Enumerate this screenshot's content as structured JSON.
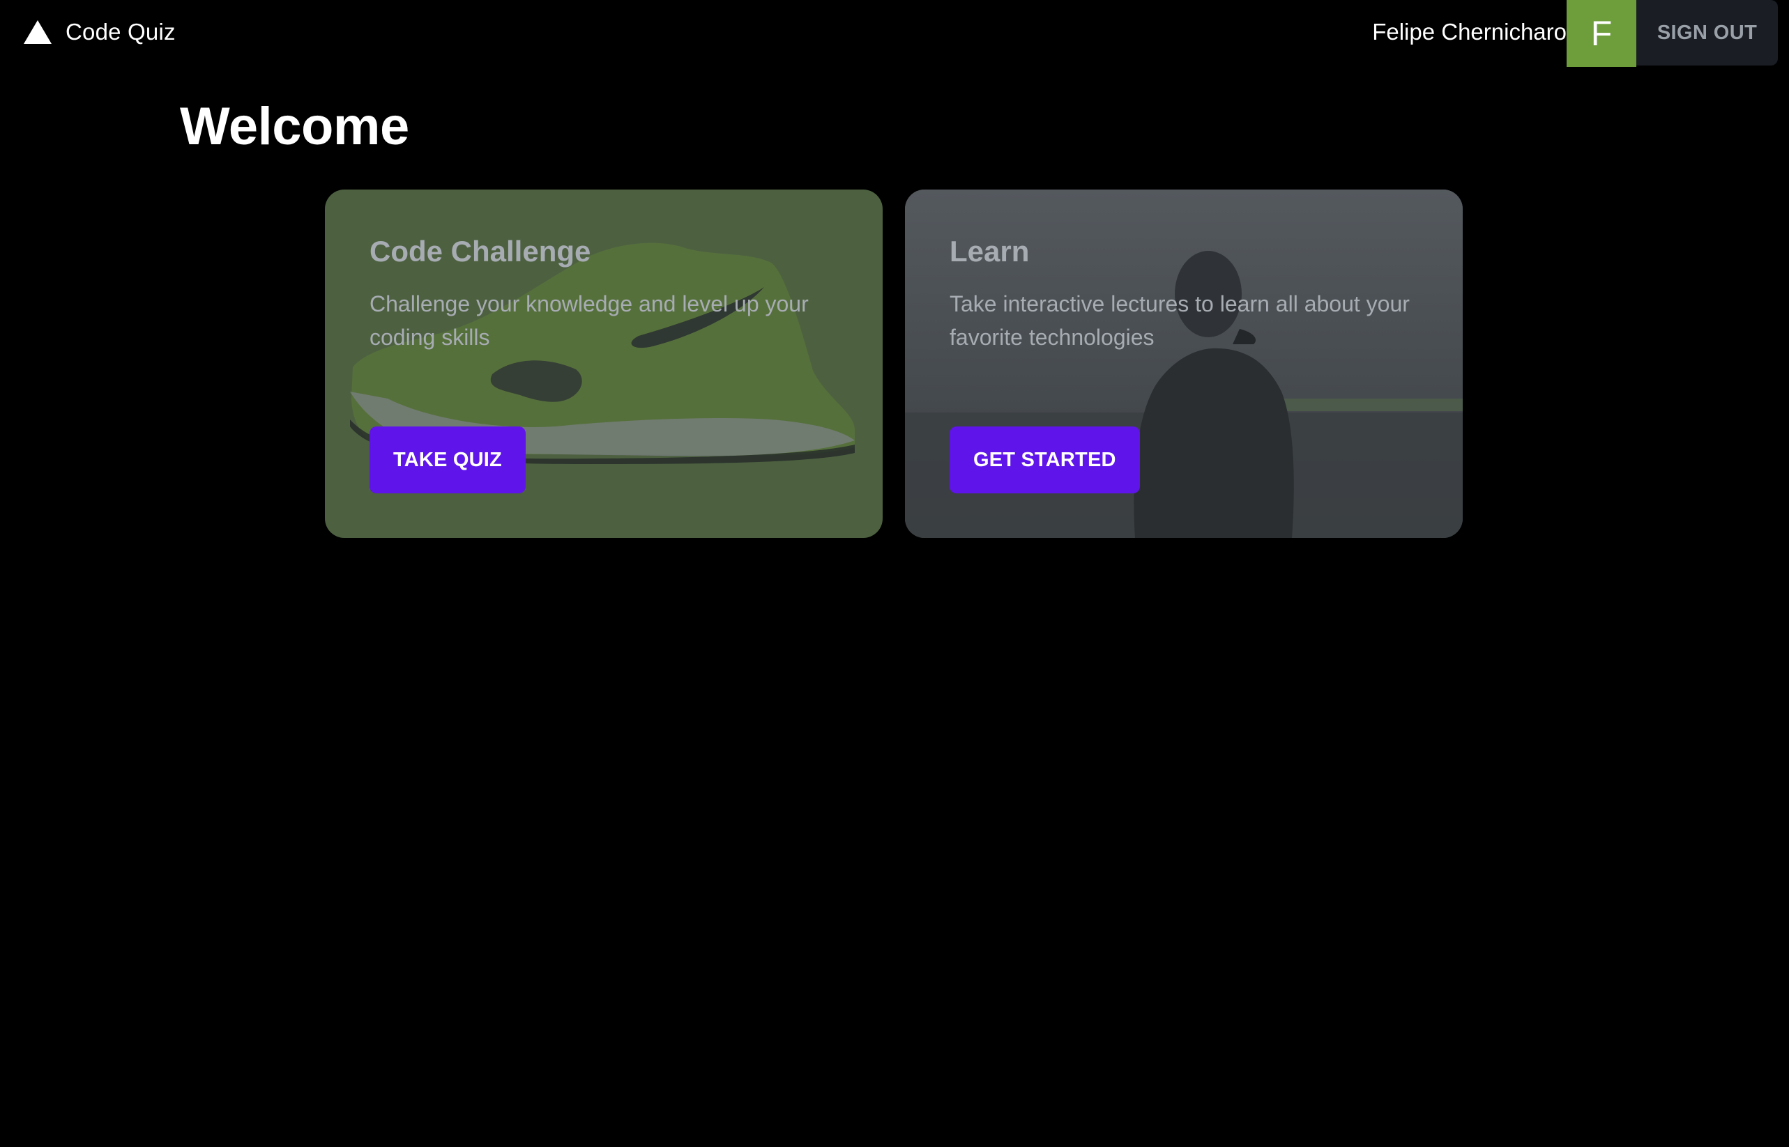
{
  "header": {
    "app_title": "Code Quiz",
    "logo_icon": "triangle-icon",
    "user_name": "Felipe Chernicharo",
    "avatar_initial": "F",
    "signout_label": "SIGN OUT"
  },
  "main": {
    "title": "Welcome"
  },
  "cards": [
    {
      "title": "Code Challenge",
      "description": "Challenge your knowledge and level up your coding skills",
      "button_label": "TAKE QUIZ",
      "background_image": "sneaker-image"
    },
    {
      "title": "Learn",
      "description": "Take interactive lectures to learn all about your favorite technologies",
      "button_label": "GET STARTED",
      "background_image": "person-by-sea-image"
    }
  ],
  "colors": {
    "background": "#000000",
    "avatar": "#6d9e3b",
    "signout_bg": "#1a1d23",
    "primary_button": "#5f15ea",
    "card_challenge": "#4d6140",
    "card_learn": "#4a4f54"
  }
}
